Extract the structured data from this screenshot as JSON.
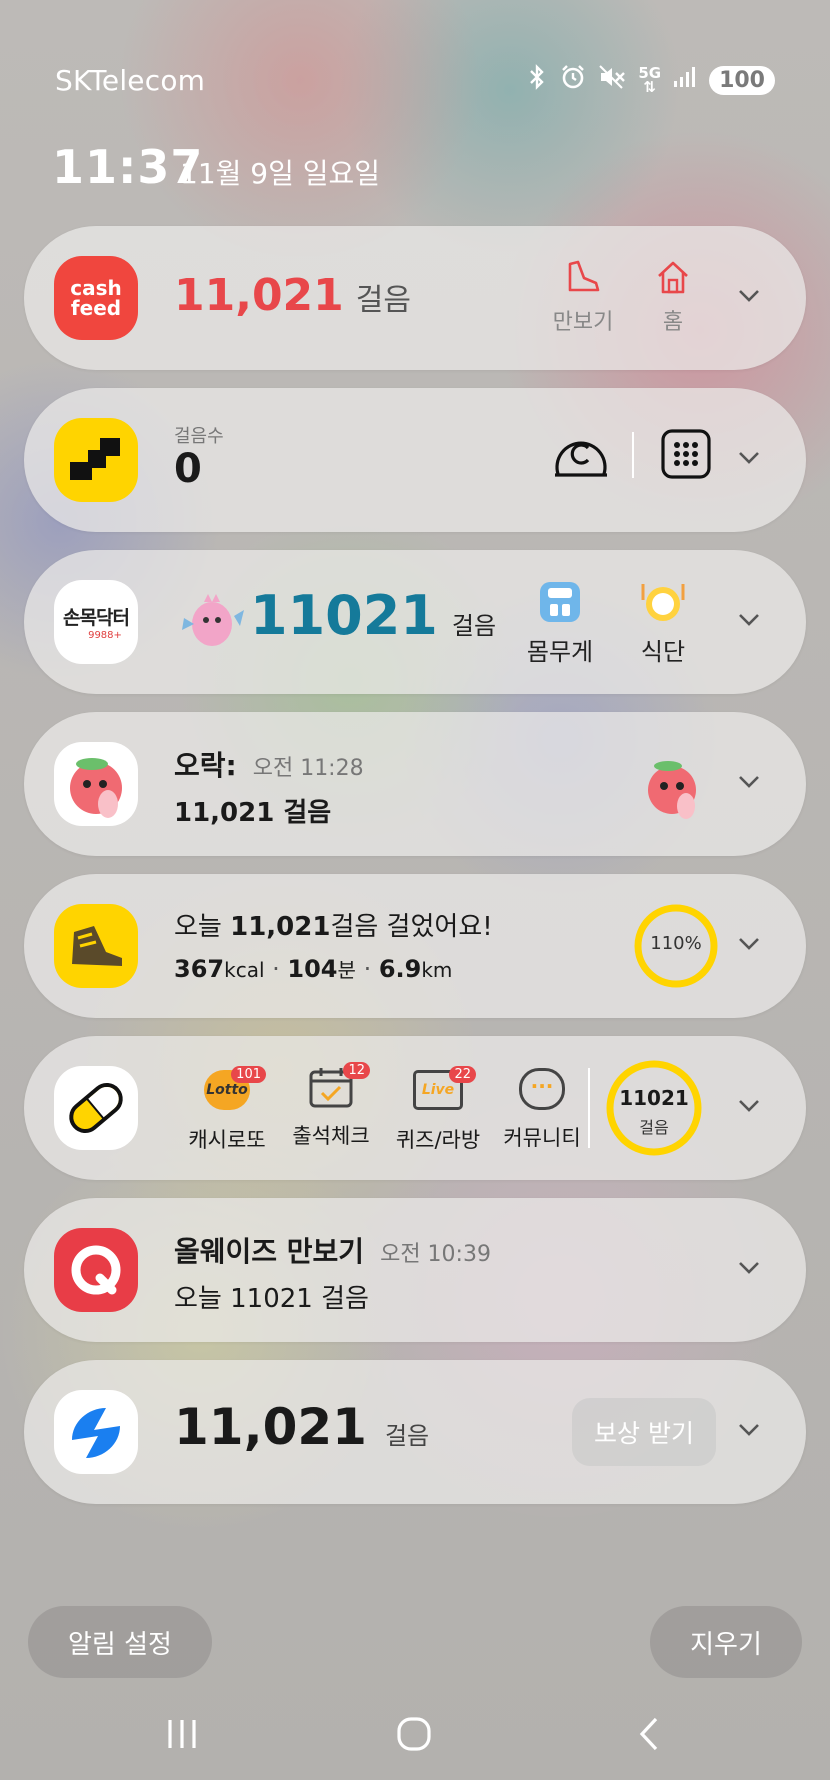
{
  "status_bar": {
    "carrier": "SKTelecom",
    "network": "5G",
    "battery": "100"
  },
  "lock": {
    "time": "11:37",
    "date": "11월 9일 일요일"
  },
  "cards": [
    {
      "app": "cash feed",
      "logo_line1": "cash",
      "logo_line2": "feed",
      "steps": "11,021",
      "unit": "걸음",
      "actions": [
        {
          "icon": "shoe-icon",
          "label": "만보기"
        },
        {
          "icon": "home-icon",
          "label": "홈"
        }
      ]
    },
    {
      "app": "stairs app",
      "label": "걸음수",
      "steps": "0"
    },
    {
      "app": "손목닥터9988",
      "logo_text": "손목닥터",
      "logo_sub": "9988+",
      "steps": "11021",
      "unit": "걸음",
      "actions": [
        {
          "icon": "scale-icon",
          "label": "몸무게"
        },
        {
          "icon": "plate-icon",
          "label": "식단"
        }
      ]
    },
    {
      "app": "오락",
      "title": "오락:",
      "time": "오전 11:28",
      "text": "11,021 걸음"
    },
    {
      "app": "walking app",
      "line1_prefix": "오늘 ",
      "line1_bold": "11,021",
      "line1_suffix": "걸음 걸었어요!",
      "kcal": "367",
      "kcal_unit": "kcal",
      "minutes": "104",
      "minutes_unit": "분",
      "km": "6.9",
      "km_unit": "km",
      "progress_label": "110%",
      "progress": 1.1
    },
    {
      "app": "cashwalk",
      "items": [
        {
          "icon": "lotto-icon",
          "badge": "101",
          "label": "캐시로또",
          "icon_text": "Lotto"
        },
        {
          "icon": "calendar-check-icon",
          "badge": "12",
          "label": "출석체크"
        },
        {
          "icon": "live-tv-icon",
          "badge": "22",
          "label": "퀴즈/라방",
          "icon_text": "Live"
        },
        {
          "icon": "chat-bubble-icon",
          "label": "커뮤니티",
          "icon_text": "···"
        }
      ],
      "steps": "11021",
      "unit": "걸음"
    },
    {
      "app": "올웨이즈 만보기",
      "title": "올웨이즈 만보기",
      "time": "오전 10:39",
      "text": "오늘 11021 걸음"
    },
    {
      "app": "toss",
      "steps": "11,021",
      "unit": "걸음",
      "button": "보상 받기"
    }
  ],
  "bottom": {
    "settings": "알림 설정",
    "clear": "지우기"
  },
  "colors": {
    "cashfeed": "#f0463e",
    "cashfeed_steps": "#e8474a",
    "sonmok_steps": "#157a9a",
    "yellow": "#ffd400",
    "alwayz": "#e83d47",
    "toss_blue": "#1a7ff0"
  }
}
